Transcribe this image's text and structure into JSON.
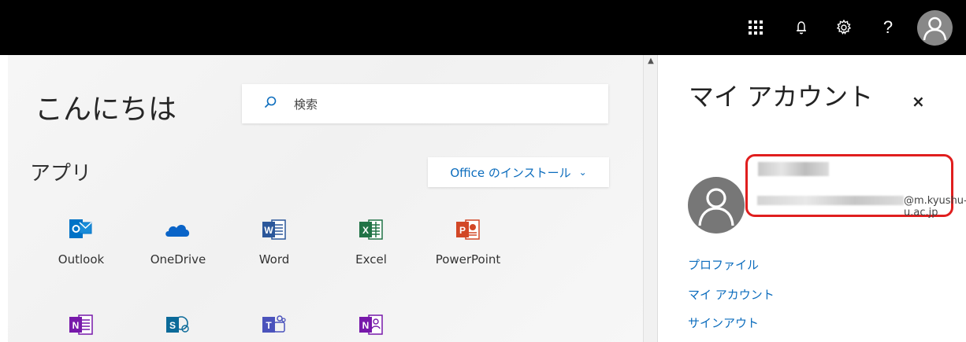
{
  "header": {
    "icons": [
      "app-launcher-icon",
      "bell-icon",
      "gear-icon",
      "help-icon",
      "avatar"
    ],
    "help_label": "?"
  },
  "main": {
    "greeting": "こんにちは",
    "search_placeholder": "検索",
    "apps_title": "アプリ",
    "install_label": "Office のインストール",
    "apps": [
      {
        "label": "Outlook",
        "color": "#0072c6"
      },
      {
        "label": "OneDrive",
        "color": "#0a64c8"
      },
      {
        "label": "Word",
        "color": "#2b579a"
      },
      {
        "label": "Excel",
        "color": "#217346"
      },
      {
        "label": "PowerPoint",
        "color": "#d24726"
      }
    ],
    "apps_second_row": [
      {
        "name": "onenote",
        "color": "#7719aa"
      },
      {
        "name": "sharepoint",
        "color": "#0b6a99"
      },
      {
        "name": "teams",
        "color": "#4b53bc"
      },
      {
        "name": "onenote-class",
        "color": "#7719aa"
      }
    ]
  },
  "panel": {
    "title": "マイ アカウント",
    "close": "×",
    "email_domain": "@m.kyushu-u.ac.jp",
    "links": [
      "プロファイル",
      "マイ アカウント",
      "サインアウト"
    ]
  },
  "colors": {
    "accent_blue": "#0b6cbd",
    "highlight_red": "#e01e1e"
  }
}
